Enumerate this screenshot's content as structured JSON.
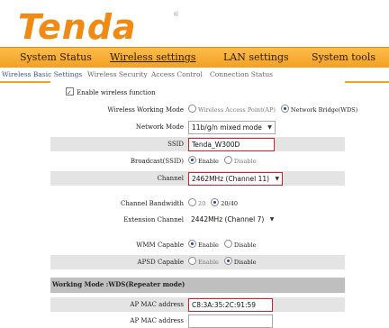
{
  "brand": {
    "logo_text": "Tenda",
    "registered_mark": "®"
  },
  "main_nav": [
    {
      "label": "System Status",
      "active": false
    },
    {
      "label": "Wireless settings",
      "active": true
    },
    {
      "label": "LAN settings",
      "active": false
    },
    {
      "label": "System tools",
      "active": false
    }
  ],
  "sub_nav": [
    {
      "label": "Wireless Basic Settings",
      "active": true
    },
    {
      "label": "Wireless Security",
      "active": false
    },
    {
      "label": "Access Control",
      "active": false
    },
    {
      "label": "Connection Status",
      "active": false
    }
  ],
  "form": {
    "enable_wireless": {
      "label": "Enable wireless function",
      "checked": true
    },
    "working_mode": {
      "label": "Wireless Working Mode",
      "options": [
        "Wireless Access Point(AP)",
        "Network Bridge(WDS)"
      ],
      "selected": "Network Bridge(WDS)"
    },
    "network_mode": {
      "label": "Network Mode",
      "value": "11b/g/n mixed mode"
    },
    "ssid": {
      "label": "SSID",
      "value": "Tenda_W300D"
    },
    "broadcast": {
      "label": "Broadcast(SSID)",
      "options": [
        "Enable",
        "Disable"
      ],
      "selected": "Enable"
    },
    "channel": {
      "label": "Channel",
      "value": "2462MHz (Channel 11)"
    },
    "bandwidth": {
      "label": "Channel Bandwidth",
      "options": [
        "20",
        "20/40"
      ],
      "selected": "20/40"
    },
    "extension_channel": {
      "label": "Extension Channel",
      "value": "2442MHz (Channel 7)"
    },
    "wmm": {
      "label": "WMM Capable",
      "options": [
        "Enable",
        "Disable"
      ],
      "selected": "Enable"
    },
    "apsd": {
      "label": "APSD Capable",
      "options": [
        "Enable",
        "Disable"
      ],
      "selected": "Disable"
    },
    "wds_header": "Working Mode :WDS(Repeater mode)",
    "ap_mac_1": {
      "label": "AP MAC address",
      "value": "C8:3A:35:2C:91:59"
    },
    "ap_mac_2": {
      "label": "AP MAC address",
      "value": ""
    }
  },
  "colors": {
    "accent": "#f5a020",
    "highlight_border": "#d2202a",
    "row_shade": "#e4e4e4",
    "header_shade": "#bfbfbf"
  }
}
